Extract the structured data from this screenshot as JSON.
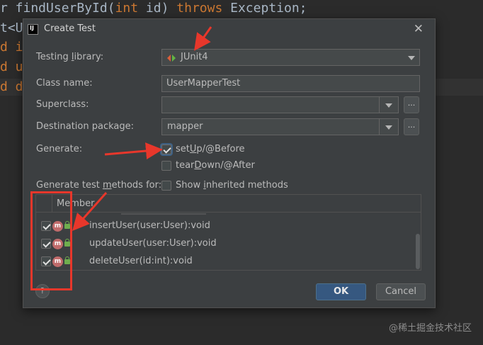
{
  "editor": {
    "line1_pre": "r findUserById(",
    "line1_kw1": "int",
    "line1_mid": " id) ",
    "line1_kw2": "throws",
    "line1_post": " Exception;",
    "line2": "t<U",
    "line3": "d i",
    "line4": "d u",
    "line5": "d d"
  },
  "dialog": {
    "title": "Create Test",
    "app_icon": "intellij-icon",
    "fields": {
      "testing_library": {
        "label_pre": "Testing ",
        "label_u": "l",
        "label_post": "ibrary:",
        "value": "JUnit4",
        "icon": "junit-icon"
      },
      "class_name": {
        "label": "Class name:",
        "value": "UserMapperTest"
      },
      "superclass": {
        "label": "Superclass:",
        "value": ""
      },
      "destination_package": {
        "label": "Destination package:",
        "value": "mapper"
      }
    },
    "generate": {
      "label": "Generate:",
      "setup": {
        "label_pre": "set",
        "label_u": "U",
        "label_post": "p/@Before",
        "checked": true
      },
      "teardown": {
        "label_pre": "tear",
        "label_u": "D",
        "label_post": "own/@After",
        "checked": false
      }
    },
    "methods": {
      "label_pre": "Generate test ",
      "label_u": "m",
      "label_post": "ethods for:",
      "show_inherited": {
        "label_pre": "Show ",
        "label_u": "i",
        "label_post": "nherited methods",
        "checked": false
      }
    },
    "table": {
      "header": "Member",
      "rows": [
        {
          "name": "insertUser(user:User):void",
          "checked": true,
          "icon": "method-icon",
          "badge": "m"
        },
        {
          "name": "updateUser(user:User):void",
          "checked": true,
          "icon": "method-icon",
          "badge": "m"
        },
        {
          "name": "deleteUser(id:int):void",
          "checked": true,
          "icon": "method-icon",
          "badge": "m"
        }
      ]
    },
    "buttons": {
      "ok": "OK",
      "cancel": "Cancel",
      "help": "?",
      "browse": "..."
    }
  },
  "watermark": "@稀土掘金技术社区",
  "colors": {
    "annotation": "#e8372b",
    "accent_button": "#365880",
    "dialog_bg": "#3c3f41",
    "editor_bg": "#2b2b2b",
    "keyword": "#cc7832"
  }
}
